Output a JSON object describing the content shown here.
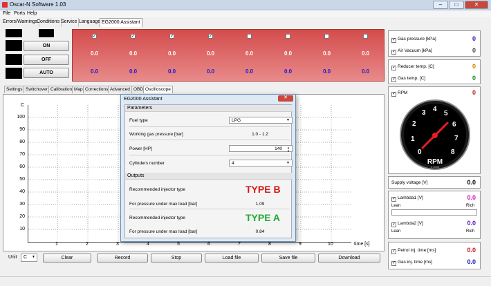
{
  "window": {
    "title": "Oscar-N Software 1.03"
  },
  "menu": [
    "File",
    "Ports",
    "Help"
  ],
  "main_tabs": [
    "Errors/Warnings",
    "Conditions",
    "Service",
    "Language",
    "EG2000 Assistant"
  ],
  "controls": {
    "on": "ON",
    "off": "OFF",
    "auto": "AUTO"
  },
  "red_panel": {
    "check_mark": "✓",
    "row1": [
      "0.0",
      "0.0",
      "0.0",
      "0.0",
      "0.0",
      "0.0",
      "0.0",
      "0.0"
    ],
    "row2": [
      "0.0",
      "0.0",
      "0.0",
      "0.0",
      "0.0",
      "0.0",
      "0.0",
      "0.0"
    ]
  },
  "sub_tabs": [
    "Settings",
    "Switchover",
    "Calibration",
    "Map",
    "Corrections",
    "Advanced",
    "OBD",
    "Oscilloscope"
  ],
  "oscilloscope": {
    "y_unit": "C",
    "y_ticks": [
      "100",
      "90",
      "80",
      "70",
      "60",
      "50",
      "40",
      "30",
      "20",
      "10"
    ],
    "x_ticks": [
      "1",
      "2",
      "3",
      "4",
      "5",
      "6",
      "7",
      "8",
      "9",
      "10"
    ],
    "x_label": "time [s]"
  },
  "bottom": {
    "unit_label": "Unit",
    "unit_value": "C",
    "buttons": [
      "Clear",
      "Record",
      "Stop",
      "Load file",
      "Save file",
      "Download"
    ]
  },
  "right": {
    "gas_pressure": {
      "label": "Gas pressure [kPa]",
      "value": "0",
      "color": "#1818c8"
    },
    "air_vacuum": {
      "label": "Air Vacuum [kPa]",
      "value": "0",
      "color": "#444444"
    },
    "reducer_temp": {
      "label": "Reducer temp. [C]",
      "value": "0",
      "color": "#d08000"
    },
    "gas_temp": {
      "label": "Gas temp. [C]",
      "value": "0",
      "color": "#109020"
    },
    "rpm": {
      "label": "RPM",
      "value": "0",
      "color": "#c81818",
      "gauge_text": "RPM",
      "gauge_sub": "x 1000",
      "gauge_numbers": [
        "0",
        "1",
        "2",
        "3",
        "4",
        "5",
        "6",
        "7",
        "8"
      ]
    },
    "supply_voltage": {
      "label": "Supply voltage [V]",
      "value": "0.0"
    },
    "lambda1": {
      "label": "Lambda1 [V]",
      "value": "0.0",
      "color": "#d018c8",
      "lean": "Lean",
      "rich": "Rich"
    },
    "lambda2": {
      "label": "Lambda2 [V]",
      "value": "0.0",
      "color": "#6018c8",
      "lean": "Lean",
      "rich": "Rich"
    },
    "petrol_inj": {
      "label": "Petrol inj. time [ms]",
      "value": "0.0",
      "color": "#d01818"
    },
    "gas_inj": {
      "label": "Gas inj. time [ms]",
      "value": "0.0",
      "color": "#1818c8"
    }
  },
  "dialog": {
    "title": "EG2000 Assistant",
    "close": "✕",
    "parameters_header": "Parameters",
    "fuel_type_label": "Fuel type",
    "fuel_type_value": "LPG",
    "working_pressure_label": "Working gas pressure [bar]",
    "working_pressure_value": "1.0 - 1.2",
    "power_label": "Power [HP]",
    "power_value": "140",
    "cylinders_label": "Cylinders number",
    "cylinders_value": "4",
    "outputs_header": "Outputs",
    "rec_injector_label_1": "Recommended injector type",
    "rec_injector_value_1": "TYPE B",
    "pressure_label_1": "For pressure under max load [bar]",
    "pressure_value_1": "1.09",
    "rec_injector_label_2": "Recommended injector type",
    "rec_injector_value_2": "TYPE A",
    "pressure_label_2": "For pressure under max load [bar]",
    "pressure_value_2": "0.84"
  }
}
